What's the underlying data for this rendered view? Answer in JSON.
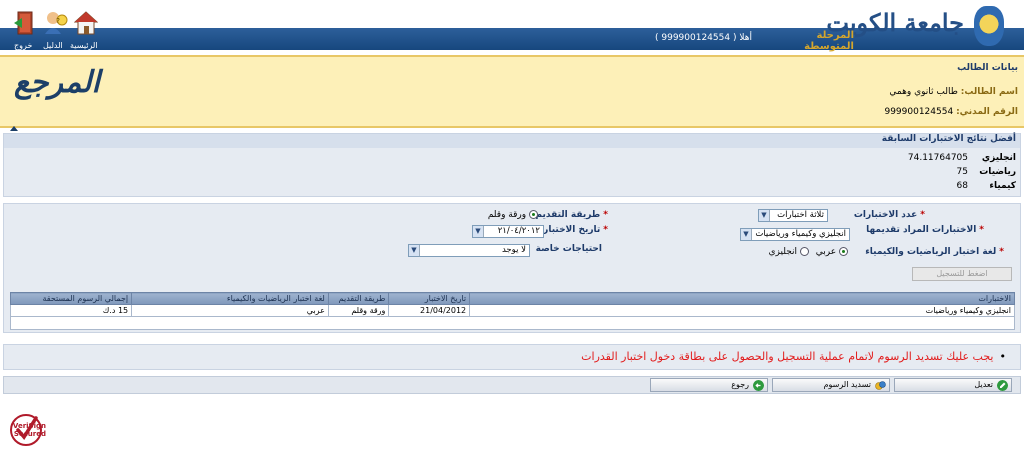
{
  "header": {
    "logo_name": "جامعة الكويت",
    "logo_subname": "المرحلة المتوسطة",
    "welcome": "أهلا ( 999900124554 )",
    "nav": {
      "home": "الرئيسية",
      "guide": "الدليل",
      "logout": "خروج"
    },
    "colors": {
      "bar": "#17477e"
    }
  },
  "student": {
    "title": "بيانات الطالب",
    "name_label": "اسم الطالب:",
    "name_value": "طالب ثانوي وهمي",
    "civil_label": "الرقم المدني:",
    "civil_value": "999900124554",
    "marja": "المرجع"
  },
  "previous": {
    "title": "أفضل نتائج الاختبارات السابقة",
    "rows": [
      {
        "subject": "انجليزي",
        "score": "74.11764705"
      },
      {
        "subject": "رياضيات",
        "score": "75"
      },
      {
        "subject": "كيمياء",
        "score": "68"
      }
    ]
  },
  "form": {
    "num_tests_label": "عدد الاختبارات",
    "num_tests_value": "ثلاثة اختبارات",
    "tests_label": "الاختبارات المراد تقديمها",
    "tests_value": "انجليزي وكيمياء ورياضيات",
    "lang_label": "لغة اختبار الرياضيات والكيمياء",
    "lang_options": [
      "عربي",
      "انجليزي"
    ],
    "method_label": "طريقة التقديم",
    "method_value": "ورقة وقلم",
    "date_label": "تاريخ الاختبار",
    "date_value": "٢١/٠٤/٢٠١٢",
    "special_label": "احتياجات خاصة",
    "special_value": "لا يوجد",
    "register_button": "اضغط للتسجيل"
  },
  "table": {
    "headers": [
      "الاختبارات",
      "تاريخ الاختبار",
      "طريقة التقديم",
      "لغة اختبار الرياضيات والكيمياء",
      "إجمالي الرسوم المستحقة"
    ],
    "rows": [
      [
        "انجليزي وكيمياء ورياضيات",
        "21/04/2012",
        "ورقة وقلم",
        "عربي",
        "15 د.ك"
      ]
    ]
  },
  "notice": "يجب عليك تسديد الرسوم لاتمام عملية التسجيل والحصول على بطاقة دخول اختبار القدرات",
  "actions": {
    "edit": "تعديل",
    "pay": "تسديد الرسوم",
    "back": "رجوع"
  },
  "verisign": {
    "line1": "VeriSign",
    "line2": "Secured"
  }
}
